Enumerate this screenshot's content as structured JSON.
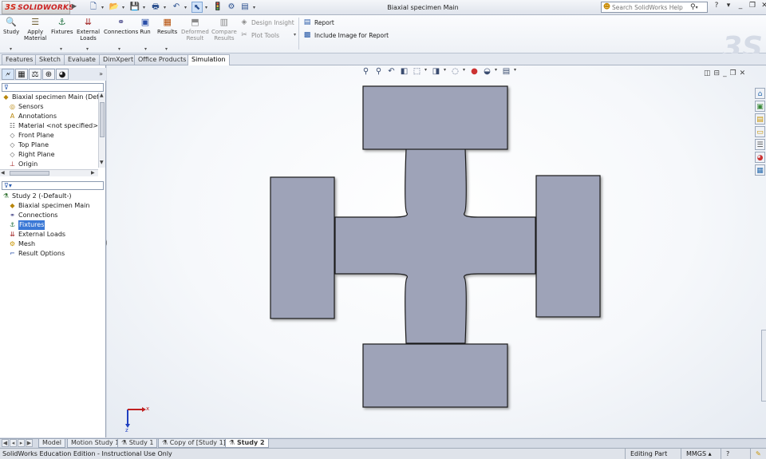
{
  "app": {
    "logo_text": "SOLIDWORKS",
    "window_title": "Biaxial specimen Main",
    "search_placeholder": "Search SolidWorks Help"
  },
  "ribbon": {
    "study": "Study",
    "apply_material": [
      "Apply",
      "Material"
    ],
    "fixtures": "Fixtures",
    "external_loads": [
      "External",
      "Loads"
    ],
    "connections": "Connections",
    "run": "Run",
    "results": "Results",
    "deformed_result": [
      "Deformed",
      "Result"
    ],
    "compare_results": [
      "Compare",
      "Results"
    ],
    "design_insight": "Design Insight",
    "plot_tools": "Plot Tools",
    "report": "Report",
    "include_image": "Include Image for Report"
  },
  "cm_tabs": [
    "Features",
    "Sketch",
    "Evaluate",
    "DimXpert",
    "Office Products",
    "Simulation"
  ],
  "feature_tree": [
    {
      "label": "Biaxial specimen Main  (Def",
      "icon": "part-icon",
      "indent": 0
    },
    {
      "label": "Sensors",
      "icon": "sensor-icon",
      "indent": 1
    },
    {
      "label": "Annotations",
      "icon": "annotation-icon",
      "indent": 1
    },
    {
      "label": "Material <not specified>",
      "icon": "material-icon",
      "indent": 1
    },
    {
      "label": "Front Plane",
      "icon": "plane-icon",
      "indent": 1
    },
    {
      "label": "Top Plane",
      "icon": "plane-icon",
      "indent": 1
    },
    {
      "label": "Right Plane",
      "icon": "plane-icon",
      "indent": 1
    },
    {
      "label": "Origin",
      "icon": "origin-icon",
      "indent": 1
    }
  ],
  "study_tree": [
    {
      "label": "Study 2 (-Default-)",
      "icon": "study-icon",
      "indent": 0
    },
    {
      "label": "Biaxial specimen Main",
      "icon": "part-icon",
      "indent": 1
    },
    {
      "label": "Connections",
      "icon": "connections-icon",
      "indent": 1
    },
    {
      "label": "Fixtures",
      "icon": "fixtures-icon",
      "indent": 1,
      "selected": true
    },
    {
      "label": "External Loads",
      "icon": "external-loads-icon",
      "indent": 1
    },
    {
      "label": "Mesh",
      "icon": "mesh-icon",
      "indent": 1
    },
    {
      "label": "Result Options",
      "icon": "result-options-icon",
      "indent": 1
    }
  ],
  "bottom_tabs": [
    "Model",
    "Motion Study 1",
    "Study 1",
    "Copy of [Study 1]",
    "Study 2"
  ],
  "status": {
    "left": "SolidWorks Education Edition - Instructional Use Only",
    "editing": "Editing Part",
    "units": "MMGS"
  },
  "colors": {
    "part_face": "#9ea3b8",
    "part_edge": "#1a1a1a",
    "accent": "#3a78d6"
  }
}
